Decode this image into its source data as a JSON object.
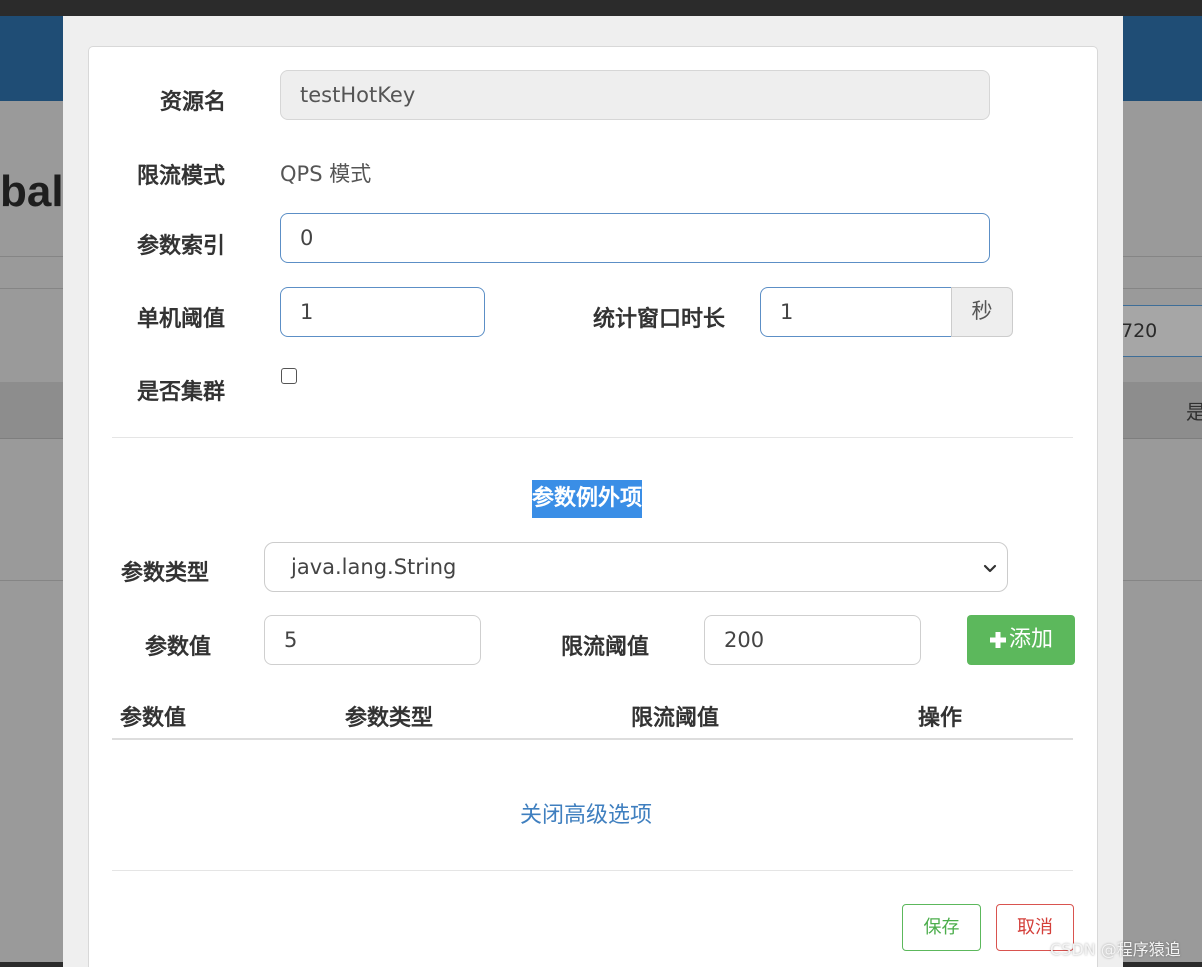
{
  "background": {
    "title_fragment": "bal",
    "input_value_fragment": "720",
    "table_header_fragment": "是"
  },
  "form": {
    "resource_name": {
      "label": "资源名",
      "value": "testHotKey"
    },
    "flow_mode": {
      "label": "限流模式",
      "value": "QPS 模式"
    },
    "param_index": {
      "label": "参数索引",
      "value": "0"
    },
    "threshold": {
      "label": "单机阈值",
      "value": "1"
    },
    "window": {
      "label": "统计窗口时长",
      "value": "1",
      "unit": "秒"
    },
    "cluster": {
      "label": "是否集群",
      "checked": false
    }
  },
  "exceptions": {
    "title": "参数例外项",
    "param_type": {
      "label": "参数类型",
      "selected": "java.lang.String"
    },
    "param_value": {
      "label": "参数值",
      "value": "5"
    },
    "limit_threshold": {
      "label": "限流阈值",
      "value": "200"
    },
    "add_label": "添加",
    "table_headers": [
      "参数值",
      "参数类型",
      "限流阈值",
      "操作"
    ]
  },
  "advanced_toggle": "关闭高级选项",
  "footer": {
    "save_label": "保存",
    "cancel_label": "取消"
  },
  "watermark": "CSDN @程序猿追",
  "icons": {
    "add": "plus-icon",
    "select": "chevron-down-icon"
  },
  "colors": {
    "primary": "#3a8ee6",
    "success": "#5cb85c",
    "danger": "#d9534f",
    "link": "#3f7fbf",
    "header": "#1f4d75"
  }
}
